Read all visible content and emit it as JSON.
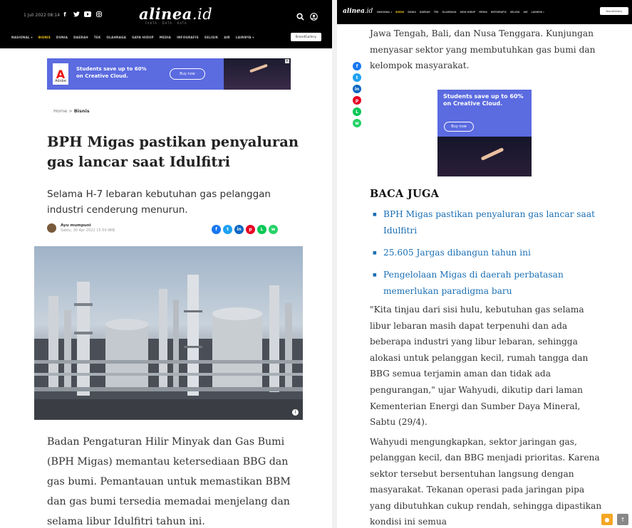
{
  "left": {
    "header": {
      "date": "1 Juli 2022 08:14",
      "logo_main": "alinea",
      "logo_ext": ".id",
      "tagline": "FAKTA · DATA · KATA",
      "social_icons": [
        "facebook-icon",
        "twitter-icon",
        "youtube-icon",
        "instagram-icon"
      ],
      "nav": [
        "NASIONAL ▾",
        "BISNIS",
        "DUNIA",
        "DAERAH",
        "TEK",
        "OLAHRAGA",
        "GAYA HIDUP",
        "MEDIA",
        "INFOGRAFIS",
        "SELISIK",
        "AIR",
        "LAINNYA ▾"
      ],
      "active_nav": "BISNIS",
      "promo": "BrandGallery"
    },
    "ad": {
      "brand": "Adobe",
      "text": "Students save up to 60% on Creative Cloud.",
      "button": "Buy now"
    },
    "breadcrumb": {
      "home": "Home",
      "sep": ">",
      "current": "Bisnis"
    },
    "title": "BPH Migas pastikan penyaluran gas lancar saat Idulfitri",
    "subtitle": "Selama H-7 lebaran kebutuhan gas pelanggan industri cenderung menurun.",
    "author": {
      "name": "Ayu mumpuni",
      "date": "Sabtu, 30 Apr 2022 15:50 WIB"
    },
    "share": [
      {
        "name": "facebook-icon",
        "color": "#1877f2",
        "glyph": "f"
      },
      {
        "name": "twitter-icon",
        "color": "#1da1f2",
        "glyph": "t"
      },
      {
        "name": "linkedin-icon",
        "color": "#0a66c2",
        "glyph": "in"
      },
      {
        "name": "pinterest-icon",
        "color": "#e60023",
        "glyph": "p"
      },
      {
        "name": "line-icon",
        "color": "#06c755",
        "glyph": "L"
      },
      {
        "name": "whatsapp-icon",
        "color": "#25d366",
        "glyph": "w"
      }
    ],
    "body": "Badan Pengaturan Hilir Minyak dan Gas Bumi (BPH Migas) memantau ketersediaan BBG dan gas bumi. Pemantauan untuk memastikan BBM dan gas bumi tersedia memadai menjelang dan selama libur Idulfitri tahun ini."
  },
  "right": {
    "header": {
      "logo_main": "alinea",
      "logo_ext": ".id",
      "nav": [
        "NASIONAL ▾",
        "BISNIS",
        "DUNIA",
        "DAERAH",
        "TEK",
        "OLAHRAGA",
        "GAYA HIDUP",
        "MEDIA",
        "INFOGRAFIS",
        "SELISIK",
        "AIR",
        "LAINNYA ▾"
      ],
      "active_nav": "BISNIS",
      "promo": "BrandGallery"
    },
    "paragraph_top": "Jawa Tengah, Bali, dan Nusa Tenggara. Kunjungan menyasar sektor yang membutuhkan gas bumi dan kelompok masyarakat.",
    "ad": {
      "text": "Students save up to 60% on Creative Cloud.",
      "button": "Buy now"
    },
    "baca_juga": {
      "heading": "BACA JUGA",
      "items": [
        "BPH Migas pastikan penyaluran gas lancar saat Idulfitri",
        "25.605 Jargas dibangun tahun ini",
        "Pengelolaan Migas di daerah perbatasan memerlukan paradigma baru"
      ]
    },
    "paragraph_quote": "\"Kita tinjau dari sisi hulu, kebutuhan gas selama libur lebaran masih dapat terpenuhi dan ada beberapa industri yang libur lebaran, sehingga alokasi untuk pelanggan kecil, rumah tangga dan BBG semua terjamin aman dan tidak ada pengurangan,\" ujar Wahyudi, dikutip dari laman Kementerian Energi dan Sumber Daya Mineral, Sabtu (29/4).",
    "paragraph_last": "Wahyudi mengungkapkan, sektor jaringan gas, pelanggan kecil, dan BBG menjadi prioritas. Karena sektor tersebut bersentuhan langsung dengan masyarakat. Tekanan operasi pada jaringan pipa yang dibutuhkan cukup rendah, sehingga dipastikan kondisi ini semua"
  }
}
